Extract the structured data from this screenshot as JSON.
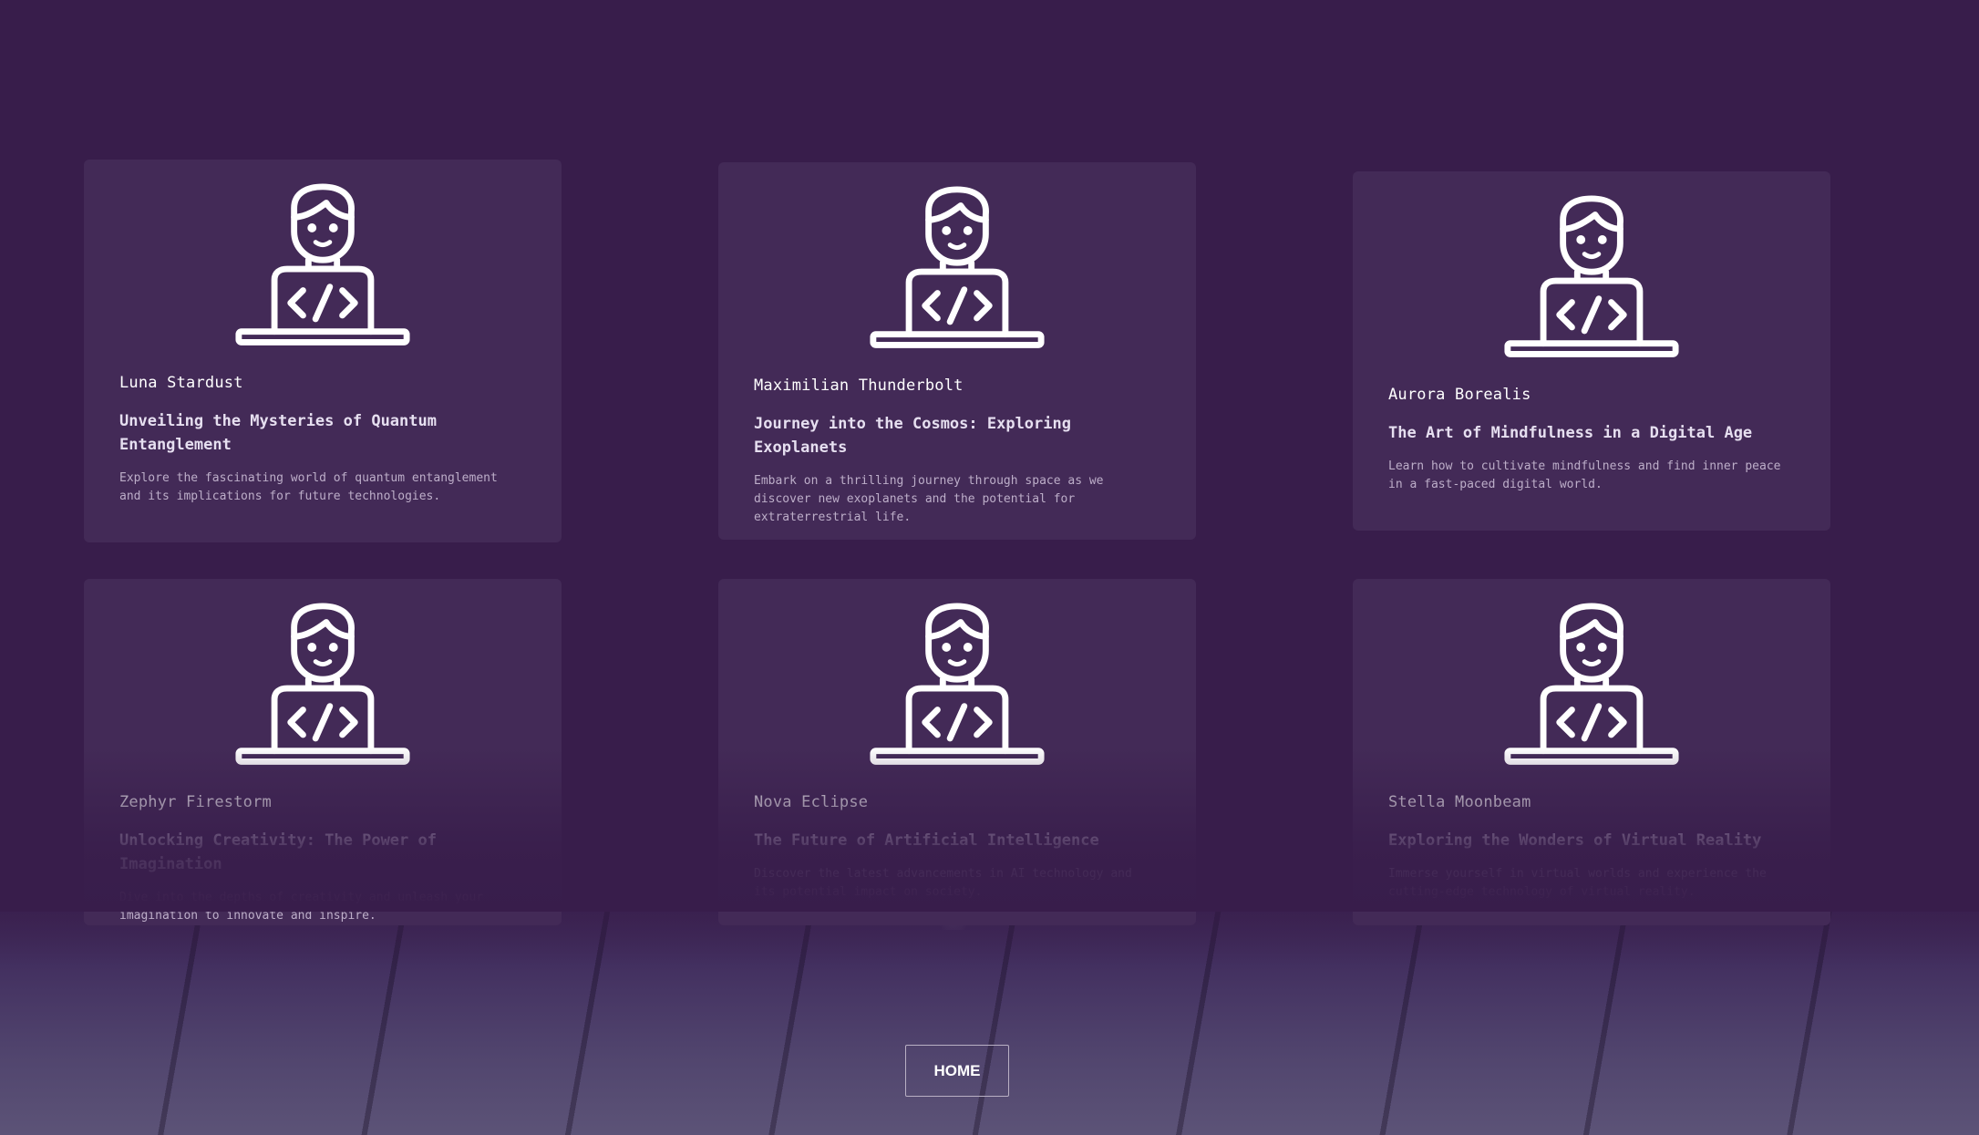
{
  "cards": [
    {
      "icon": "developer-laptop-icon",
      "name": "Luna Stardust",
      "title": "Unveiling the Mysteries of Quantum Entanglement",
      "description": "Explore the fascinating world of quantum entanglement and its implications for future technologies."
    },
    {
      "icon": "developer-laptop-icon",
      "name": "Maximilian Thunderbolt",
      "title": "Journey into the Cosmos: Exploring Exoplanets",
      "description": "Embark on a thrilling journey through space as we discover new exoplanets and the potential for extraterrestrial life."
    },
    {
      "icon": "developer-laptop-icon",
      "name": "Aurora Borealis",
      "title": "The Art of Mindfulness in a Digital Age",
      "description": "Learn how to cultivate mindfulness and find inner peace in a fast-paced digital world."
    },
    {
      "icon": "developer-laptop-icon",
      "name": "Zephyr Firestorm",
      "title": "Unlocking Creativity: The Power of Imagination",
      "description": "Dive into the depths of creativity and unleash your imagination to innovate and inspire."
    },
    {
      "icon": "developer-laptop-icon",
      "name": "Nova Eclipse",
      "title": "The Future of Artificial Intelligence",
      "description": "Discover the latest advancements in AI technology and its potential impact on society."
    },
    {
      "icon": "developer-laptop-icon",
      "name": "Stella Moonbeam",
      "title": "Exploring the Wonders of Virtual Reality",
      "description": "Immerse yourself in virtual worlds and experience the cutting-edge technology of virtual reality."
    }
  ],
  "nav": {
    "home_label": "HOME"
  },
  "colors": {
    "background": "#381d4b",
    "card": "#432a57",
    "text": "#ffffff"
  }
}
